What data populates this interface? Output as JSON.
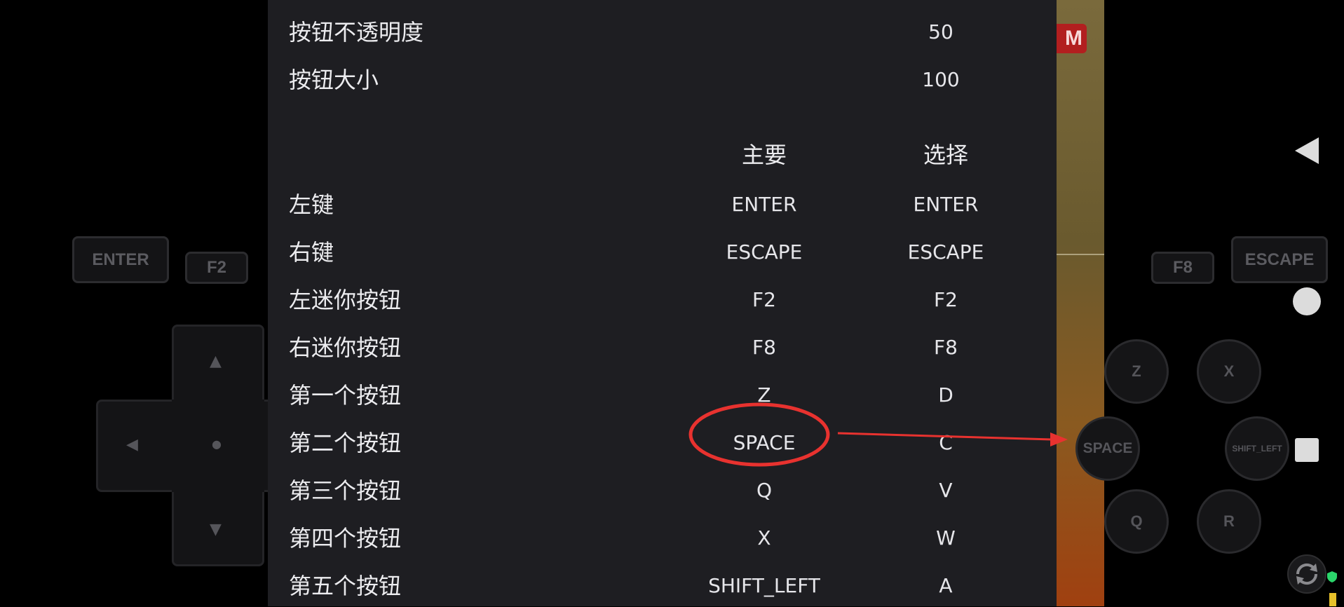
{
  "settings": {
    "opacity_label": "按钮不透明度",
    "opacity_value": "50",
    "size_label": "按钮大小",
    "size_value": "100"
  },
  "columns": {
    "primary": "主要",
    "alt": "选择"
  },
  "mappings": [
    {
      "label": "左键",
      "primary": "ENTER",
      "alt": "ENTER"
    },
    {
      "label": "右键",
      "primary": "ESCAPE",
      "alt": "ESCAPE"
    },
    {
      "label": "左迷你按钮",
      "primary": "F2",
      "alt": "F2"
    },
    {
      "label": "右迷你按钮",
      "primary": "F8",
      "alt": "F8"
    },
    {
      "label": "第一个按钮",
      "primary": "Z",
      "alt": "D"
    },
    {
      "label": "第二个按钮",
      "primary": "SPACE",
      "alt": "C"
    },
    {
      "label": "第三个按钮",
      "primary": "Q",
      "alt": "V"
    },
    {
      "label": "第四个按钮",
      "primary": "X",
      "alt": "W"
    },
    {
      "label": "第五个按钮",
      "primary": "SHIFT_LEFT",
      "alt": "A"
    }
  ],
  "left_controls": {
    "enter": "ENTER",
    "f2": "F2"
  },
  "right_controls": {
    "f8": "F8",
    "escape": "ESCAPE",
    "z": "Z",
    "x": "X",
    "space": "SPACE",
    "shift_left": "SHIFT_LEFT",
    "q": "Q",
    "r": "R"
  },
  "game": {
    "badge_text": "M"
  },
  "annotation_color": "#e8322f"
}
